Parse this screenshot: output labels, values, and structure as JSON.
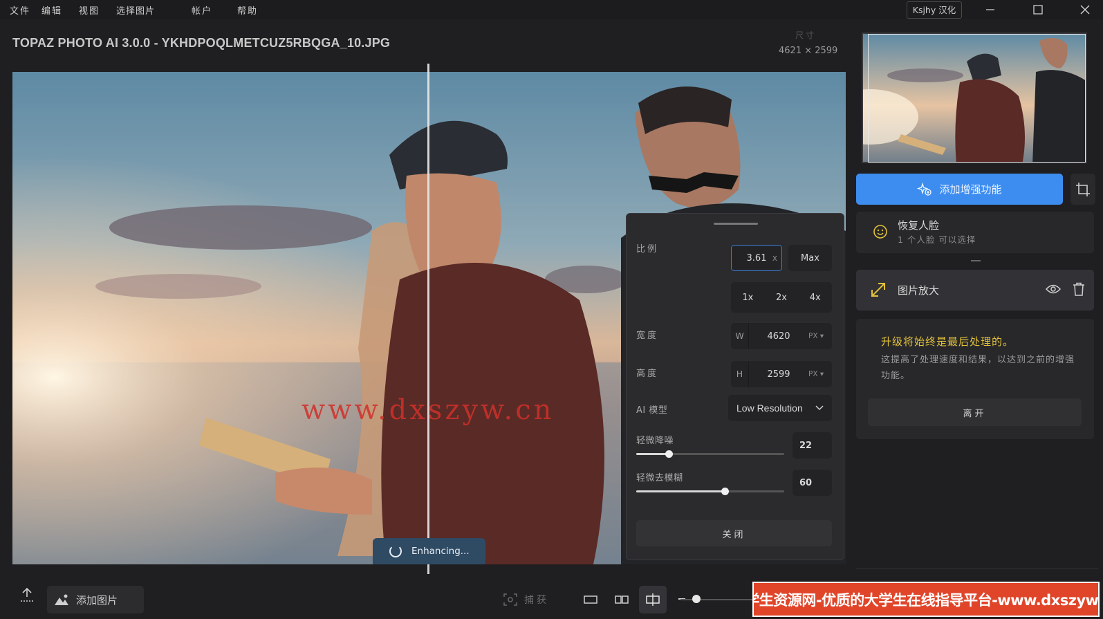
{
  "menubar": {
    "items": [
      "文件",
      "编辑",
      "视图",
      "选择图片",
      "帐户",
      "帮助"
    ],
    "user": "Ksjhy 汉化"
  },
  "document": {
    "title": "TOPAZ PHOTO AI 3.0.0 - YKHDPOQLMETCUZ5RBQGA_10.JPG",
    "size_label": "尺寸",
    "size_value": "4621 × 2599"
  },
  "canvas": {
    "watermark": "www.dxszyw.cn",
    "status": "Enhancing..."
  },
  "upscale_panel": {
    "scale_label": "比例",
    "scale_value": "3.61",
    "scale_suffix": "x",
    "max_label": "Max",
    "multipliers": [
      "1x",
      "2x",
      "4x"
    ],
    "width_label": "宽度",
    "width_prefix": "W",
    "width_value": "4620",
    "height_label": "高度",
    "height_prefix": "H",
    "height_value": "2599",
    "unit": "PX ▾",
    "model_label": "AI 模型",
    "model_value": "Low Resolution",
    "denoise_label": "轻微降噪",
    "denoise_value": "22",
    "denoise_level": 0.22,
    "deblur_label": "轻微去模糊",
    "deblur_value": "60",
    "deblur_level": 0.6,
    "close_label": "关闭"
  },
  "sidebar": {
    "add_enhancement": "添加增强功能",
    "face": {
      "title": "恢复人脸",
      "subtitle": "1 个人脸 可以选择"
    },
    "upscale": {
      "title": "图片放大"
    },
    "note": {
      "title": "升级将始终是最后处理的。",
      "body": "这提高了处理速度和结果，以达到之前的增强功能。",
      "leave": "离开"
    }
  },
  "bottombar": {
    "add_image": "添加图片",
    "capture": "捕获"
  },
  "banner": {
    "text": "大学生资源网-优质的大学生在线指导平台-www.dxszyw.cn"
  },
  "colors": {
    "accent": "#3d8cf0",
    "highlight": "#e2c23a",
    "banner": "#e0452a"
  }
}
